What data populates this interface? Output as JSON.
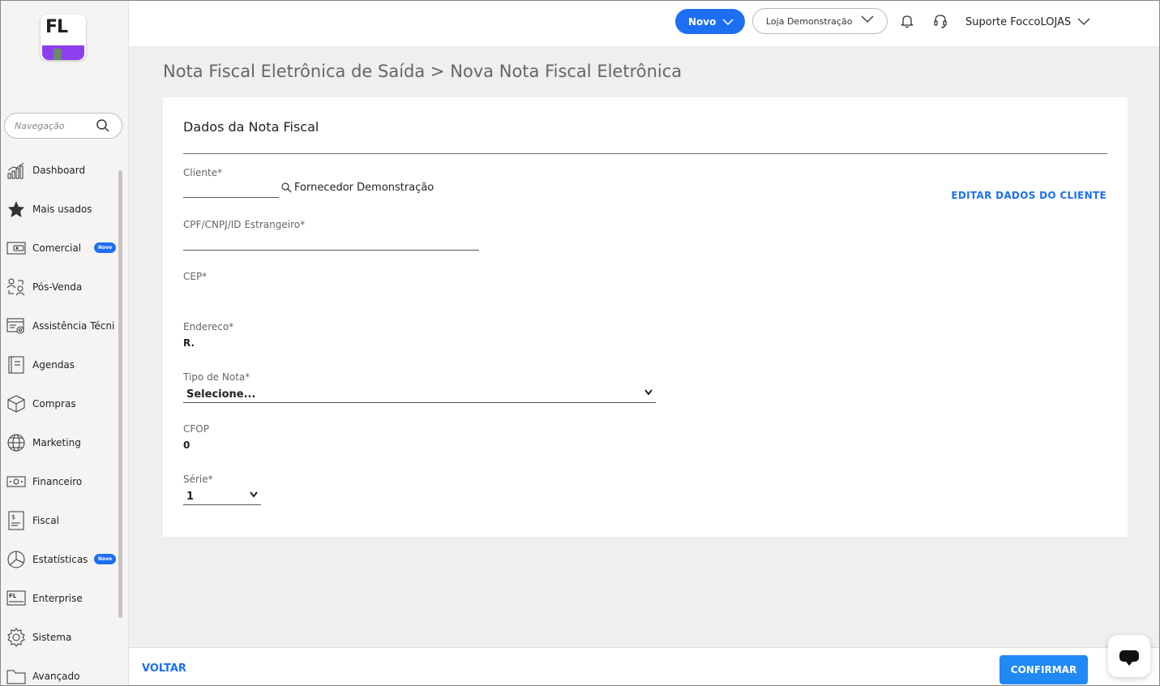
{
  "logo": {
    "text": "FL",
    "accent": "#8e3ff0"
  },
  "sidebar": {
    "search_placeholder": "Navegação",
    "items": [
      {
        "label": "Dashboard",
        "icon": "dashboard-icon"
      },
      {
        "label": "Mais usados",
        "icon": "star-icon"
      },
      {
        "label": "Comercial",
        "icon": "wallet-icon",
        "badge": "Novo"
      },
      {
        "label": "Pós-Venda",
        "icon": "people-exchange-icon"
      },
      {
        "label": "Assistência Técnica",
        "icon": "tech-service-icon"
      },
      {
        "label": "Agendas",
        "icon": "calendar-icon"
      },
      {
        "label": "Compras",
        "icon": "box-icon"
      },
      {
        "label": "Marketing",
        "icon": "globe-icon"
      },
      {
        "label": "Financeiro",
        "icon": "money-icon"
      },
      {
        "label": "Fiscal",
        "icon": "receipt-icon"
      },
      {
        "label": "Estatísticas",
        "icon": "pie-chart-icon",
        "badge": "Novo"
      },
      {
        "label": "Enterprise",
        "icon": "enterprise-icon"
      },
      {
        "label": "Sistema",
        "icon": "gear-icon"
      },
      {
        "label": "Avançado",
        "icon": "folder-icon"
      }
    ]
  },
  "header": {
    "new_button": "Novo",
    "store": "Loja Demonstração",
    "user": "Suporte FoccoLOJAS"
  },
  "breadcrumb": "Nota Fiscal Eletrônica de Saída > Nova Nota Fiscal Eletrônica",
  "form": {
    "title": "Dados da Nota Fiscal",
    "cliente_label": "Cliente*",
    "cliente_name": "Fornecedor Demonstração",
    "edit_client": "EDITAR DADOS DO CLIENTE",
    "cpf_label": "CPF/CNPJ/ID Estrangeiro*",
    "cep_label": "CEP*",
    "endereco_label": "Endereco*",
    "endereco_value": "R.",
    "tipo_label": "Tipo de Nota*",
    "tipo_value": "Selecione...",
    "cfop_label": "CFOP",
    "cfop_value": "0",
    "serie_label": "Série*",
    "serie_value": "1"
  },
  "footer": {
    "back": "VOLTAR",
    "confirm": "CONFIRMAR"
  },
  "colors": {
    "primary": "#1d6ff2",
    "confirm": "#2089f5"
  }
}
